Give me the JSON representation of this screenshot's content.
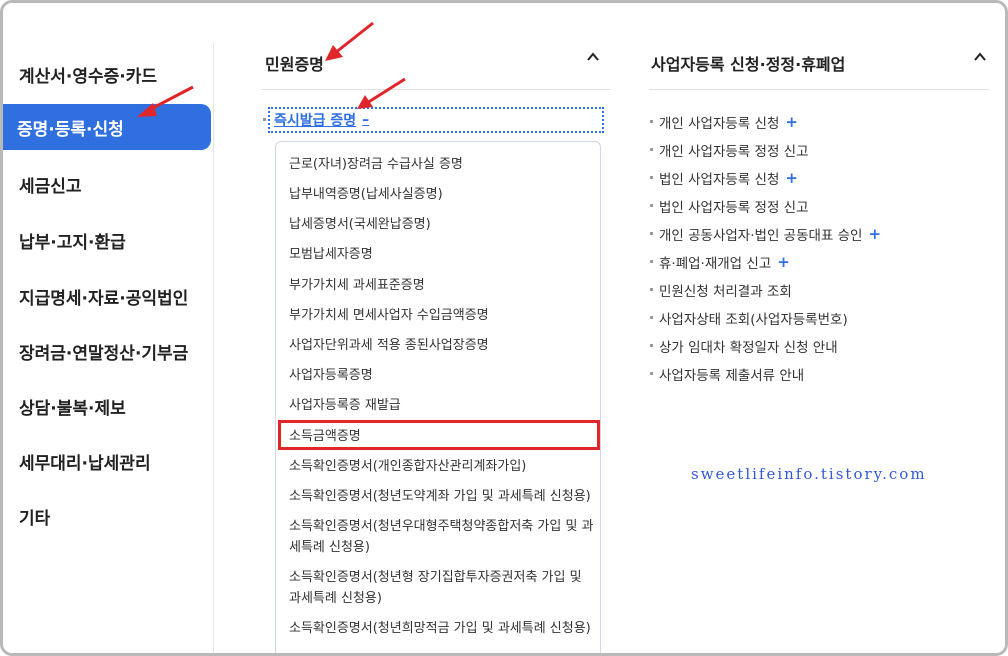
{
  "left_nav": {
    "items": [
      {
        "label": "계산서·영수증·카드",
        "active": false
      },
      {
        "label": "증명·등록·신청",
        "active": true
      },
      {
        "label": "세금신고",
        "active": false
      },
      {
        "label": "납부·고지·환급",
        "active": false
      },
      {
        "label": "지급명세·자료·공익법인",
        "active": false
      },
      {
        "label": "장려금·연말정산·기부금",
        "active": false
      },
      {
        "label": "상담·불복·제보",
        "active": false
      },
      {
        "label": "세무대리·납세관리",
        "active": false
      },
      {
        "label": "기타",
        "active": false
      }
    ]
  },
  "civil_section": {
    "title": "민원증명",
    "chevron": "chevron-up-icon",
    "subheading": "즉시발급 증명",
    "subheading_toggle": "–",
    "items": [
      "근로(자녀)장려금 수급사실 증명",
      "납부내역증명(납세사실증명)",
      "납세증명서(국세완납증명)",
      "모범납세자증명",
      "부가가치세 과세표준증명",
      "부가가치세 면세사업자 수입금액증명",
      "사업자단위과세 적용 종된사업장증명",
      "사업자등록증명",
      "사업자등록증 재발급",
      "소득금액증명",
      "소득확인증명서(개인종합자산관리계좌가입)",
      "소득확인증명서(청년도약계좌 가입 및 과세특례 신청용)",
      "소득확인증명서(청년우대형주택청약종합저축 가입 및 과세특례 신청용)",
      "소득확인증명서(청년형 장기집합투자증권저축 가입 및 과세특례 신청용)",
      "소득확인증명서(청년희망적금 가입 및 과세특례 신청용)"
    ],
    "highlighted_index": 9
  },
  "biz_section": {
    "title": "사업자등록 신청·정정·휴폐업",
    "chevron": "chevron-up-icon",
    "items": [
      {
        "label": "개인 사업자등록 신청",
        "plus": true
      },
      {
        "label": "개인 사업자등록 정정 신고",
        "plus": false
      },
      {
        "label": "법인 사업자등록 신청",
        "plus": true
      },
      {
        "label": "법인 사업자등록 정정 신고",
        "plus": false
      },
      {
        "label": "개인 공동사업자·법인 공동대표 승인",
        "plus": true
      },
      {
        "label": "휴·폐업·재개업 신고",
        "plus": true
      },
      {
        "label": "민원신청 처리결과 조회",
        "plus": false
      },
      {
        "label": "사업자상태 조회(사업자등록번호)",
        "plus": false
      },
      {
        "label": "상가 임대차 확정일자 신청 안내",
        "plus": false
      },
      {
        "label": "사업자등록 제출서류 안내",
        "plus": false
      }
    ],
    "plus_symbol": "+"
  },
  "watermark": "sweetlifeinfo.tistory.com",
  "colors": {
    "accent": "#2f6fe0",
    "highlight_box": "#e0262b",
    "arrow": "#e0262b"
  }
}
